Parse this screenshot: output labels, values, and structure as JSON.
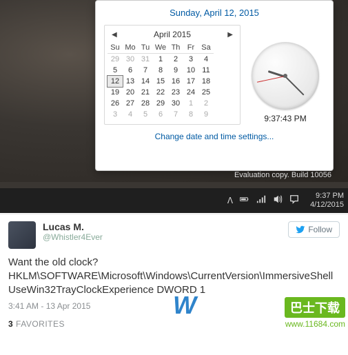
{
  "clock_flyout": {
    "full_date": "Sunday, April 12, 2015",
    "month_title": "April 2015",
    "prev": "◀",
    "next": "▶",
    "day_headers": [
      "Su",
      "Mo",
      "Tu",
      "We",
      "Th",
      "Fr",
      "Sa"
    ],
    "weeks": [
      [
        {
          "d": "29",
          "o": true
        },
        {
          "d": "30",
          "o": true
        },
        {
          "d": "31",
          "o": true
        },
        {
          "d": "1"
        },
        {
          "d": "2"
        },
        {
          "d": "3"
        },
        {
          "d": "4"
        }
      ],
      [
        {
          "d": "5"
        },
        {
          "d": "6"
        },
        {
          "d": "7"
        },
        {
          "d": "8"
        },
        {
          "d": "9"
        },
        {
          "d": "10"
        },
        {
          "d": "11"
        }
      ],
      [
        {
          "d": "12",
          "t": true
        },
        {
          "d": "13"
        },
        {
          "d": "14"
        },
        {
          "d": "15"
        },
        {
          "d": "16"
        },
        {
          "d": "17"
        },
        {
          "d": "18"
        }
      ],
      [
        {
          "d": "19"
        },
        {
          "d": "20"
        },
        {
          "d": "21"
        },
        {
          "d": "22"
        },
        {
          "d": "23"
        },
        {
          "d": "24"
        },
        {
          "d": "25"
        }
      ],
      [
        {
          "d": "26"
        },
        {
          "d": "27"
        },
        {
          "d": "28"
        },
        {
          "d": "29"
        },
        {
          "d": "30"
        },
        {
          "d": "1",
          "o": true
        },
        {
          "d": "2",
          "o": true
        }
      ],
      [
        {
          "d": "3",
          "o": true
        },
        {
          "d": "4",
          "o": true
        },
        {
          "d": "5",
          "o": true
        },
        {
          "d": "6",
          "o": true
        },
        {
          "d": "7",
          "o": true
        },
        {
          "d": "8",
          "o": true
        },
        {
          "d": "9",
          "o": true
        }
      ]
    ],
    "digital_time": "9:37:43 PM",
    "settings_link": "Change date and time settings..."
  },
  "watermark": "Evaluation copy. Build 10056",
  "taskbar": {
    "chevron": "ᐱ",
    "time": "9:37 PM",
    "date": "4/12/2015"
  },
  "tweet": {
    "name": "Lucas M.",
    "handle": "@Whistler4Ever",
    "follow_label": "Follow",
    "body_line1": "Want the old clock?",
    "body_line2": "HKLM\\SOFTWARE\\Microsoft\\Windows\\CurrentVersion\\ImmersiveShell UseWin32TrayClockExperience DWORD 1",
    "timestamp": "3:41 AM - 13 Apr 2015",
    "fav_count": "3",
    "fav_label": "FAVORITES"
  },
  "overlay": {
    "w_text": "W",
    "bar_text": "巴士下载",
    "url_text": "www.11684.com"
  }
}
